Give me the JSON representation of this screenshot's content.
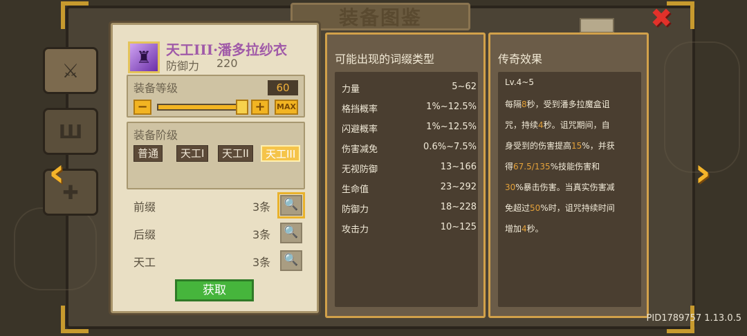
{
  "header": {
    "title": "装备图鉴"
  },
  "item": {
    "name": "天工III·潘多拉纱衣",
    "stat_label": "防御力",
    "stat_value": "220"
  },
  "level_section": {
    "title": "装备等级",
    "value": "60",
    "minus": "−",
    "plus": "+",
    "max": "MAX",
    "slider_fraction": 1.0
  },
  "tier_section": {
    "title": "装备阶级",
    "tiers": [
      "普通",
      "天工I",
      "天工II",
      "天工III"
    ],
    "selected_index": 3
  },
  "affixes": [
    {
      "label": "前缀",
      "count": "3条"
    },
    {
      "label": "后缀",
      "count": "3条"
    },
    {
      "label": "天工",
      "count": "3条"
    }
  ],
  "obtain_label": "获取",
  "possible_affixes": {
    "title": "可能出现的词缀类型",
    "rows": [
      {
        "name": "力量",
        "range": "5~62"
      },
      {
        "name": "格挡概率",
        "range": "1%~12.5%"
      },
      {
        "name": "闪避概率",
        "range": "1%~12.5%"
      },
      {
        "name": "伤害减免",
        "range": "0.6%~7.5%"
      },
      {
        "name": "无视防御",
        "range": "13~166"
      },
      {
        "name": "生命值",
        "range": "23~292"
      },
      {
        "name": "防御力",
        "range": "18~228"
      },
      {
        "name": "攻击力",
        "range": "10~125"
      }
    ]
  },
  "legendary": {
    "title": "传奇效果",
    "level": "Lv.4~5",
    "l1": [
      "每隔",
      "8",
      "秒，受到潘多拉魔盒诅"
    ],
    "l2": [
      "咒，持续",
      "4",
      "秒。诅咒期间，自"
    ],
    "l3": [
      "身受到的伤害提高",
      "15",
      "%，并获"
    ],
    "l4": [
      "得",
      "67.5/135",
      "%技能伤害和"
    ],
    "l5": [
      "",
      "30",
      "%暴击伤害。当真实伤害减"
    ],
    "l6": [
      "免超过",
      "50",
      "%时，诅咒持续时间"
    ],
    "l7": [
      "增加",
      "4",
      "秒。"
    ]
  },
  "footer": {
    "pid": "PID1789757 1.13.0.5"
  },
  "colors": {
    "gold": "#f2b422",
    "highlight": "#e3a13a",
    "close": "#e2312a",
    "green": "#46b53c"
  },
  "icons": [
    "sword-icon",
    "armor-icon",
    "accessory-icon",
    "close-icon",
    "arrow-left-icon",
    "arrow-right-icon",
    "magnifier-icon"
  ]
}
